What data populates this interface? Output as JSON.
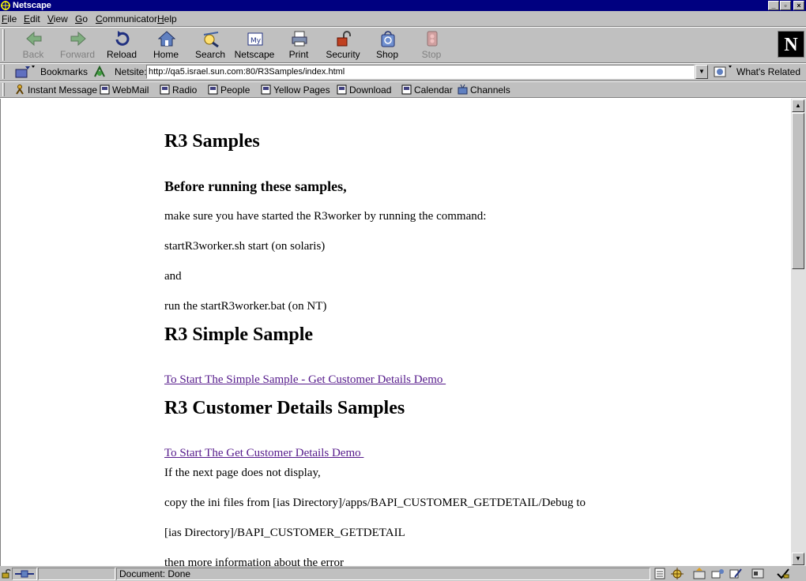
{
  "window": {
    "title": "Netscape"
  },
  "menu": [
    {
      "pre": "",
      "u": "F",
      "post": "ile"
    },
    {
      "pre": "",
      "u": "E",
      "post": "dit"
    },
    {
      "pre": "",
      "u": "V",
      "post": "iew"
    },
    {
      "pre": "",
      "u": "G",
      "post": "o"
    },
    {
      "pre": "",
      "u": "C",
      "post": "ommunicator"
    },
    {
      "pre": "",
      "u": "H",
      "post": "elp"
    }
  ],
  "toolbar": {
    "back": "Back",
    "forward": "Forward",
    "reload": "Reload",
    "home": "Home",
    "search": "Search",
    "netscape": "Netscape",
    "print": "Print",
    "security": "Security",
    "shop": "Shop",
    "stop": "Stop",
    "logo": "N"
  },
  "location": {
    "bookmarks": "Bookmarks",
    "netsite_label": "Netsite:",
    "url": "http://qa5.israel.sun.com:80/R3Samples/index.html",
    "whats_related": "What's Related"
  },
  "personal": {
    "instant_message": "Instant Message",
    "webmail": "WebMail",
    "radio": "Radio",
    "people": "People",
    "yellow_pages": "Yellow Pages",
    "download": "Download",
    "calendar": "Calendar",
    "channels": "Channels"
  },
  "page": {
    "h1_samples": "R3 Samples",
    "h3_before": "Before running these samples,",
    "p1": "make sure you have started the R3worker by running the command:",
    "p2": "startR3worker.sh start (on solaris)",
    "p3": "and",
    "p4": "run the startR3worker.bat (on NT)",
    "h1_simple": "R3 Simple Sample",
    "link_simple": "To Start The Simple Sample - Get Customer Details Demo ",
    "h1_customer": "R3 Customer Details Samples",
    "link_customer": "To Start The Get Customer Details Demo ",
    "p5": "If the next page does not display,",
    "p6": "copy the ini files from [ias Directory]/apps/BAPI_CUSTOMER_GETDETAIL/Debug to",
    "p7": "[ias Directory]/BAPI_CUSTOMER_GETDETAIL",
    "p8": "then more information about the error"
  },
  "status": {
    "text": "Document: Done"
  },
  "colors": {
    "titlebar": "#000080",
    "visited_link": "#551a8b",
    "chrome": "#c0c0c0"
  }
}
